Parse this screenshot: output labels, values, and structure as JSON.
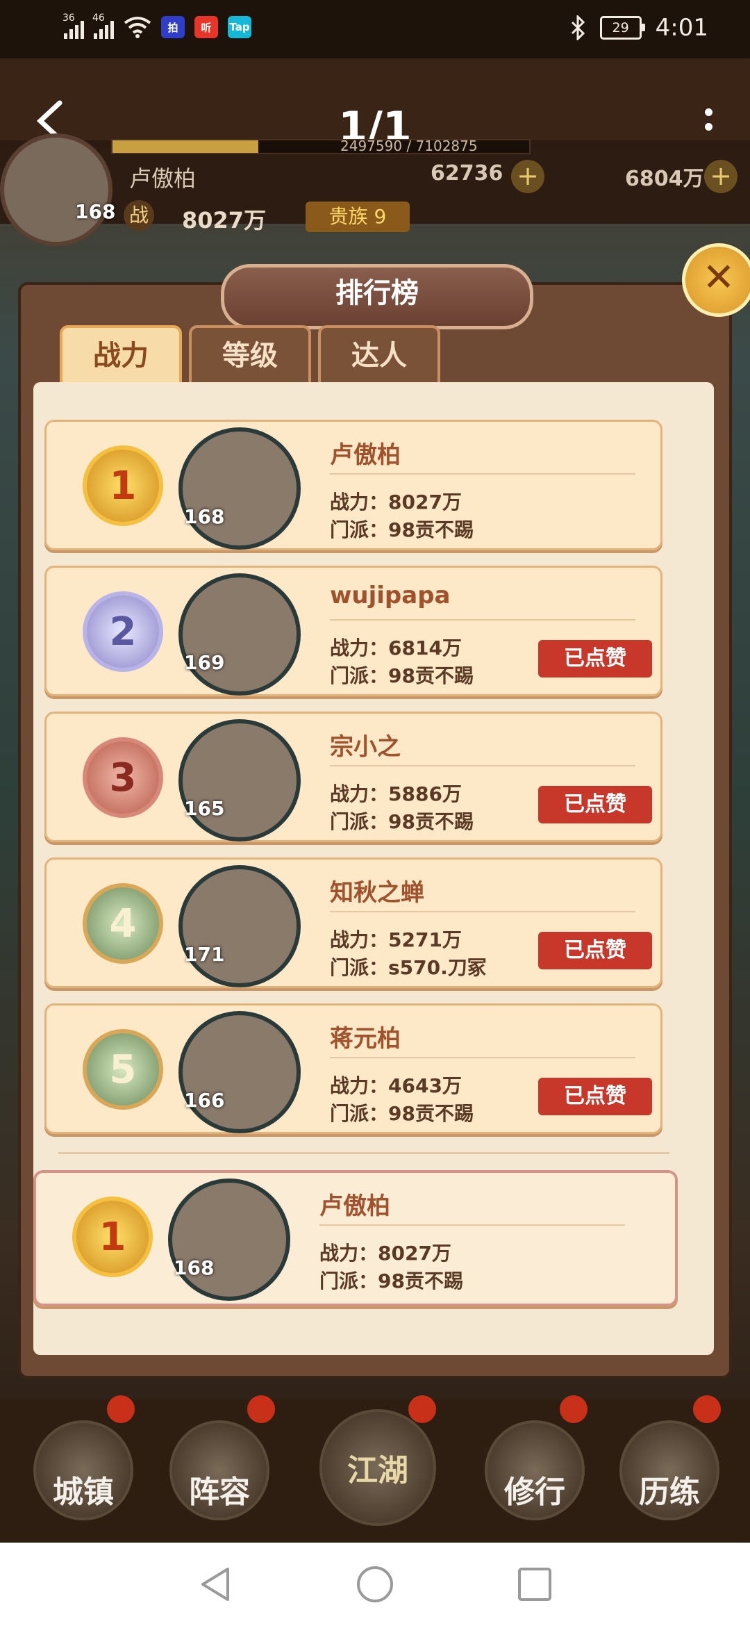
{
  "status_bar": {
    "signal1_label": "36",
    "signal2_label": "46",
    "app_icons": [
      {
        "name": "baidu-app-icon",
        "glyph": "拍",
        "color": "#2f3ec8"
      },
      {
        "name": "listen-app-icon",
        "glyph": "听",
        "color": "#e8352a"
      },
      {
        "name": "taptap-app-icon",
        "glyph": "Tap",
        "color": "#16b8d8"
      }
    ],
    "battery": "29",
    "time": "4:01"
  },
  "header": {
    "page_indicator": "1/1"
  },
  "player": {
    "name": "卢傲柏",
    "level": "168",
    "power_label": "战",
    "power": "8027万",
    "vip": "贵族 9",
    "exp_text": "2497590 / 7102875",
    "exp_fraction": 0.35,
    "gold": "62736",
    "silver": "6804万"
  },
  "panel": {
    "title": "排行榜",
    "tabs": [
      "战力",
      "等级",
      "达人"
    ],
    "active_tab": 0
  },
  "rankings": [
    {
      "rank": "1",
      "medal": "gold",
      "name": "卢傲柏",
      "level": "168",
      "power": "战力：8027万",
      "sect": "门派：98贡不踢",
      "liked": ""
    },
    {
      "rank": "2",
      "medal": "silver",
      "name": "wujipapa",
      "level": "169",
      "power": "战力：6814万",
      "sect": "门派：98贡不踢",
      "liked": "已点赞"
    },
    {
      "rank": "3",
      "medal": "bronze",
      "name": "宗小之",
      "level": "165",
      "power": "战力：5886万",
      "sect": "门派：98贡不踢",
      "liked": "已点赞"
    },
    {
      "rank": "4",
      "medal": "plain",
      "name": "知秋之蝉",
      "level": "171",
      "power": "战力：5271万",
      "sect": "门派：s570.刀冢",
      "liked": "已点赞"
    },
    {
      "rank": "5",
      "medal": "plain",
      "name": "蒋元柏",
      "level": "166",
      "power": "战力：4643万",
      "sect": "门派：98贡不踢",
      "liked": "已点赞"
    }
  ],
  "my_rank": {
    "rank": "1",
    "name": "卢傲柏",
    "level": "168",
    "power": "战力：8027万",
    "sect": "门派：98贡不踢"
  },
  "bottom_nav": [
    "城镇",
    "阵容",
    "江湖",
    "修行",
    "历练"
  ]
}
